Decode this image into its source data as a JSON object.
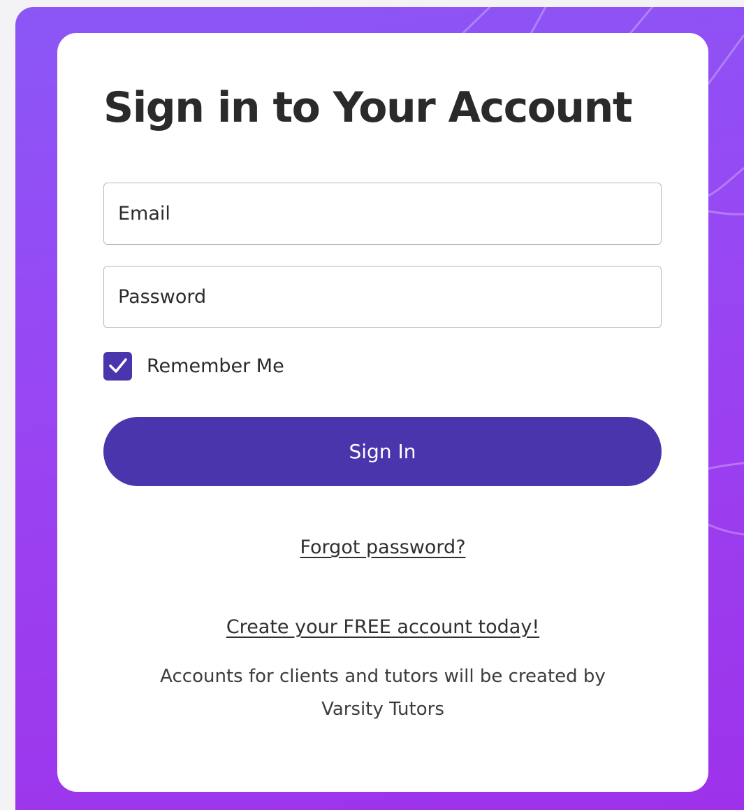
{
  "colors": {
    "accent": "#4a35ad",
    "background_purple": "#9a43f2",
    "card": "#ffffff",
    "text": "#2a2a2a"
  },
  "login": {
    "title": "Sign in to Your Account",
    "email_placeholder": "Email",
    "email_value": "",
    "password_placeholder": "Password",
    "password_value": "",
    "remember_label": "Remember Me",
    "remember_checked": true,
    "sign_in_label": "Sign In",
    "forgot_password_label": "Forgot password?",
    "create_account_label": "Create your FREE account today!",
    "note_text": "Accounts for clients and tutors will be created by Varsity Tutors"
  },
  "icons": {
    "remember_check": "checkmark-icon"
  }
}
